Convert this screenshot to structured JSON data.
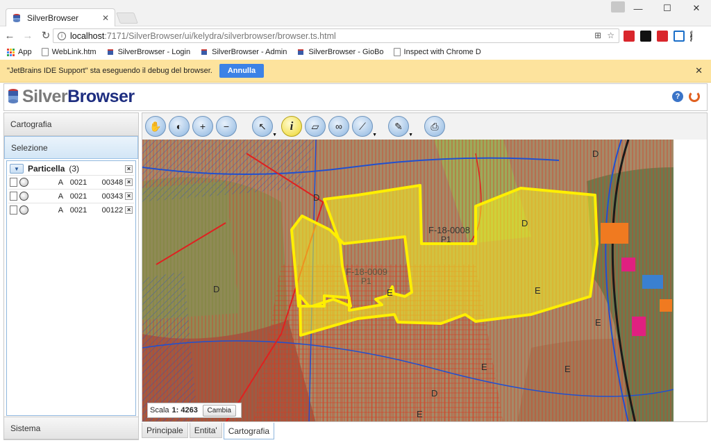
{
  "browser": {
    "tab_title": "SilverBrowser",
    "url_host": "localhost",
    "url_rest": ":7171/SilverBrowser/ui/kelydra/silverbrowser/browser.ts.html",
    "bookmarks": [
      "App",
      "WebLink.htm",
      "SilverBrowser - Login",
      "SilverBrowser - Admin",
      "SilverBrowser - GioBo",
      "Inspect with Chrome D"
    ],
    "infobar_text": "\"JetBrains IDE Support\" sta eseguendo il debug del browser.",
    "infobar_button": "Annulla",
    "ext_colors": [
      "#d9262c",
      "#111111",
      "#d9262c",
      "#1a6ec8"
    ]
  },
  "app": {
    "logo_silver": "Silver",
    "logo_browser": "Browser",
    "help": "?"
  },
  "sidebar": {
    "cartografia": "Cartografia",
    "selezione": "Selezione",
    "sistema": "Sistema",
    "group_label": "Particella",
    "group_count": "(3)",
    "rows": [
      {
        "a": "A",
        "b": "0021",
        "c": "00348"
      },
      {
        "a": "A",
        "b": "0021",
        "c": "00343"
      },
      {
        "a": "A",
        "b": "0021",
        "c": "00122"
      }
    ]
  },
  "map": {
    "tools": [
      "pan-icon",
      "globe-icon",
      "zoom-in-icon",
      "zoom-out-icon",
      "select-icon",
      "info-icon",
      "eraser-icon",
      "binoculars-icon",
      "ruler-icon",
      "pen-icon",
      "print-icon"
    ],
    "labels": [
      {
        "text": "F-18-0008",
        "sub": "P1"
      },
      {
        "text": "F-18-0009",
        "sub": "P1"
      }
    ],
    "zone_letters": [
      "D",
      "E",
      "E",
      "D",
      "D",
      "E",
      "E",
      "E",
      "D",
      "E",
      "D"
    ],
    "scale_label": "Scala",
    "scale_value": "1: 4263",
    "scale_button": "Cambia"
  },
  "tabs": [
    "Principale",
    "Entita'",
    "Cartografia"
  ]
}
